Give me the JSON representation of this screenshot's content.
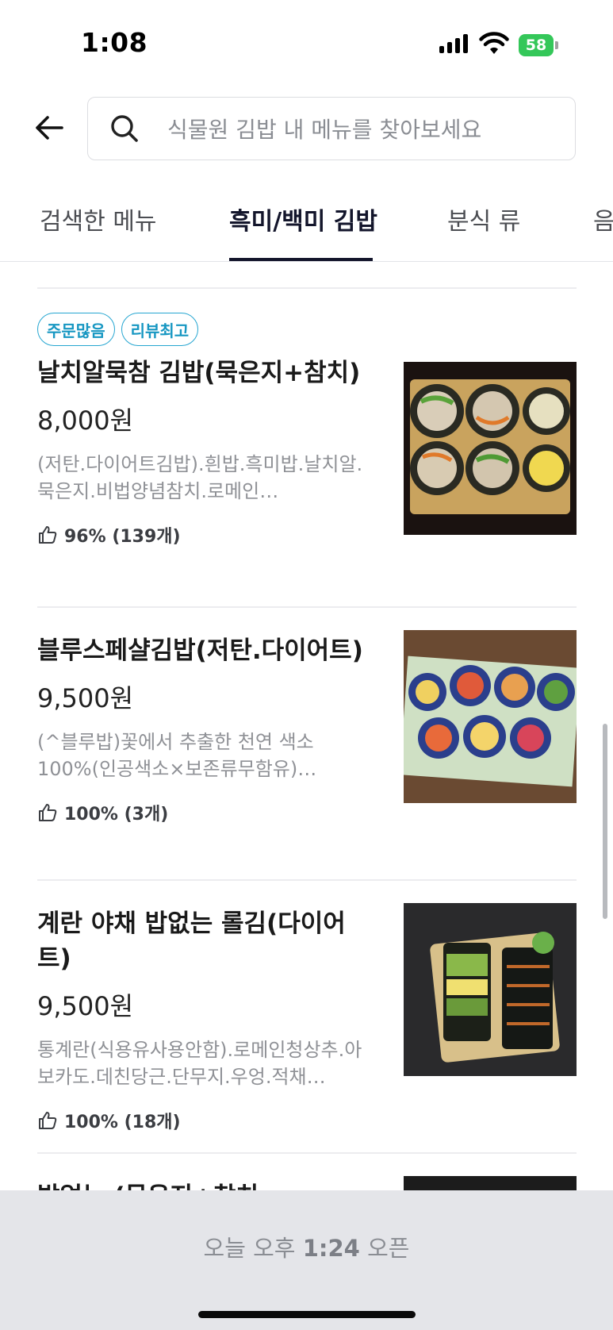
{
  "status_bar": {
    "time": "1:08",
    "battery_level": "58",
    "icons": [
      "signal-icon",
      "wifi-icon",
      "battery-icon"
    ]
  },
  "header": {
    "back_icon": "arrow-left-icon",
    "search_icon": "search-icon",
    "search_placeholder": "식물원 김밥 내 메뉴를 찾아보세요"
  },
  "tabs": [
    {
      "label": "검색한 메뉴",
      "active": false
    },
    {
      "label": "흑미/백미 김밥",
      "active": true
    },
    {
      "label": "분식 류",
      "active": false
    },
    {
      "label": "음",
      "active": false
    }
  ],
  "menu_items": [
    {
      "badges": [
        "주문많음",
        "리뷰최고"
      ],
      "name": "날치알묵참 김밥(묵은지+참치)",
      "price": "8,000원",
      "description": "(저탄.다이어트김밥).흰밥.흑미밥.날치알.묵은지.비법양념참치.로메인…",
      "rating": "96% (139개)"
    },
    {
      "badges": [],
      "name": "블루스페샬김밥(저탄.다이어트)",
      "price": "9,500원",
      "description": "(^블루밥)꽃에서 추출한 천연 색소 100%(인공색소×보존류무함유)…",
      "rating": "100% (3개)"
    },
    {
      "badges": [],
      "name": "계란 야채 밥없는 롤김(다이어트)",
      "price": "9,500원",
      "description": "통계란(식용유사용안함).로메인청상추.아보카도.데친당근.단무지.우엉.적채…",
      "rating": "100% (18개)"
    },
    {
      "badges": [],
      "name": "밥없는 (묵은지+참치",
      "price": "",
      "description": "",
      "rating": ""
    }
  ],
  "bottom_bar": {
    "prefix": "오늘 오후 ",
    "time": "1:24",
    "suffix": " 오픈"
  },
  "colors": {
    "accent_tab": "#13152b",
    "badge": "#26a6d1",
    "battery": "#34c759",
    "bottom_bar_bg": "#e4e5e9"
  }
}
